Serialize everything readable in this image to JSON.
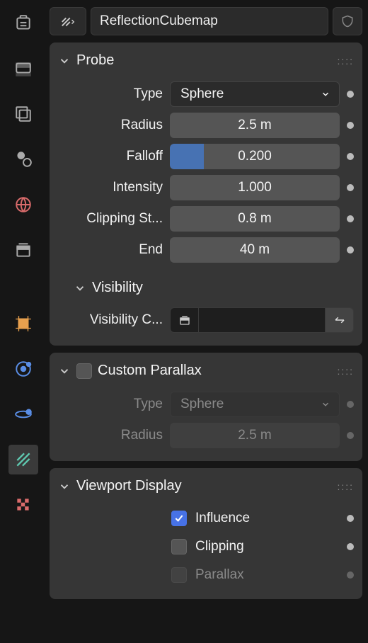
{
  "header": {
    "object_name": "ReflectionCubemap"
  },
  "probe": {
    "title": "Probe",
    "type_label": "Type",
    "type_value": "Sphere",
    "radius_label": "Radius",
    "radius_value": "2.5 m",
    "falloff_label": "Falloff",
    "falloff_value": "0.200",
    "falloff_fill_pct": 20,
    "intensity_label": "Intensity",
    "intensity_value": "1.000",
    "clip_start_label": "Clipping St...",
    "clip_start_value": "0.8 m",
    "clip_end_label": "End",
    "clip_end_value": "40 m",
    "visibility_title": "Visibility",
    "vis_collection_label": "Visibility C..."
  },
  "custom_parallax": {
    "title": "Custom Parallax",
    "enabled": false,
    "type_label": "Type",
    "type_value": "Sphere",
    "radius_label": "Radius",
    "radius_value": "2.5 m"
  },
  "viewport_display": {
    "title": "Viewport Display",
    "influence_label": "Influence",
    "influence_checked": true,
    "clipping_label": "Clipping",
    "clipping_checked": false,
    "parallax_label": "Parallax",
    "parallax_checked": false,
    "parallax_disabled": true
  }
}
